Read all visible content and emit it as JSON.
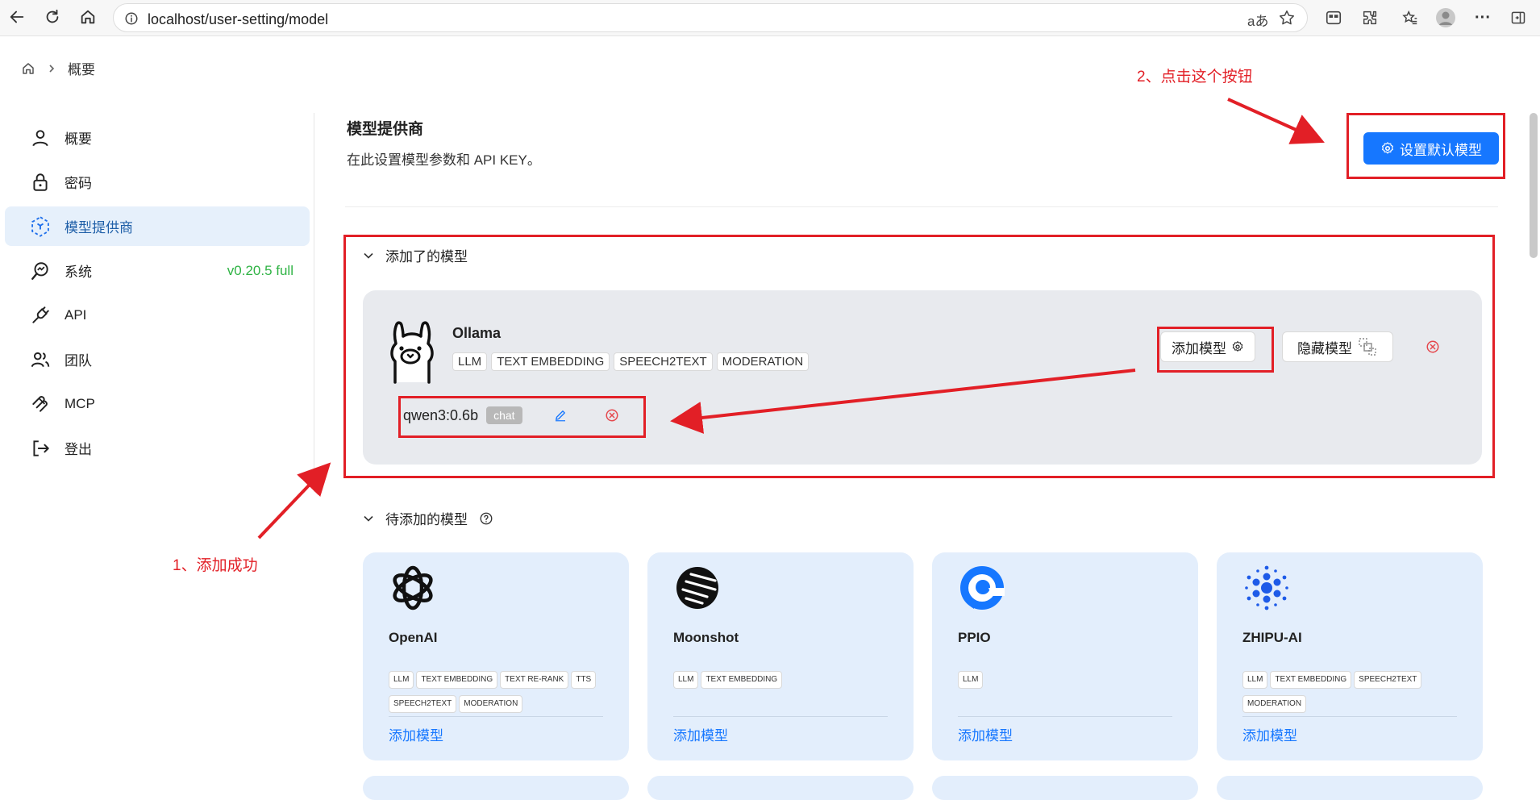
{
  "browser": {
    "url": "localhost/user-setting/model"
  },
  "breadcrumb": {
    "current": "概要"
  },
  "sidebar": {
    "items": [
      {
        "label": "概要",
        "icon": "user-icon"
      },
      {
        "label": "密码",
        "icon": "lock-icon"
      },
      {
        "label": "模型提供商",
        "icon": "model-provider-icon"
      },
      {
        "label": "系统",
        "icon": "system-icon"
      },
      {
        "label": "API",
        "icon": "plug-icon"
      },
      {
        "label": "团队",
        "icon": "team-icon"
      },
      {
        "label": "MCP",
        "icon": "mcp-icon"
      },
      {
        "label": "登出",
        "icon": "logout-icon"
      }
    ],
    "version": "v0.20.5 full"
  },
  "header": {
    "title": "模型提供商",
    "description": "在此设置模型参数和 API KEY。",
    "default_model_button": "设置默认模型"
  },
  "added_section": {
    "title": "添加了的模型",
    "provider": {
      "name": "Ollama",
      "tags": [
        "LLM",
        "TEXT EMBEDDING",
        "SPEECH2TEXT",
        "MODERATION"
      ],
      "add_button": "添加模型",
      "hide_button": "隐藏模型",
      "model": {
        "name": "qwen3:0.6b",
        "type": "chat"
      }
    }
  },
  "pending_section": {
    "title": "待添加的模型",
    "providers": [
      {
        "name": "OpenAI",
        "tags": [
          "LLM",
          "TEXT EMBEDDING",
          "TEXT RE-RANK",
          "TTS",
          "SPEECH2TEXT",
          "MODERATION"
        ],
        "link": "添加模型",
        "icon": "openai-logo-icon"
      },
      {
        "name": "Moonshot",
        "tags": [
          "LLM",
          "TEXT EMBEDDING"
        ],
        "link": "添加模型",
        "icon": "moonshot-logo-icon"
      },
      {
        "name": "PPIO",
        "tags": [
          "LLM"
        ],
        "link": "添加模型",
        "icon": "ppio-logo-icon"
      },
      {
        "name": "ZHIPU-AI",
        "tags": [
          "LLM",
          "TEXT EMBEDDING",
          "SPEECH2TEXT",
          "MODERATION"
        ],
        "link": "添加模型",
        "icon": "zhipu-logo-icon"
      }
    ]
  },
  "annotations": {
    "step1": "1、添加成功",
    "step2": "2、点击这个按钮",
    "color": "#e21f26"
  },
  "colors": {
    "primary": "#1677ff",
    "version_green": "#2fb344",
    "card_blue": "#e3eefc"
  }
}
